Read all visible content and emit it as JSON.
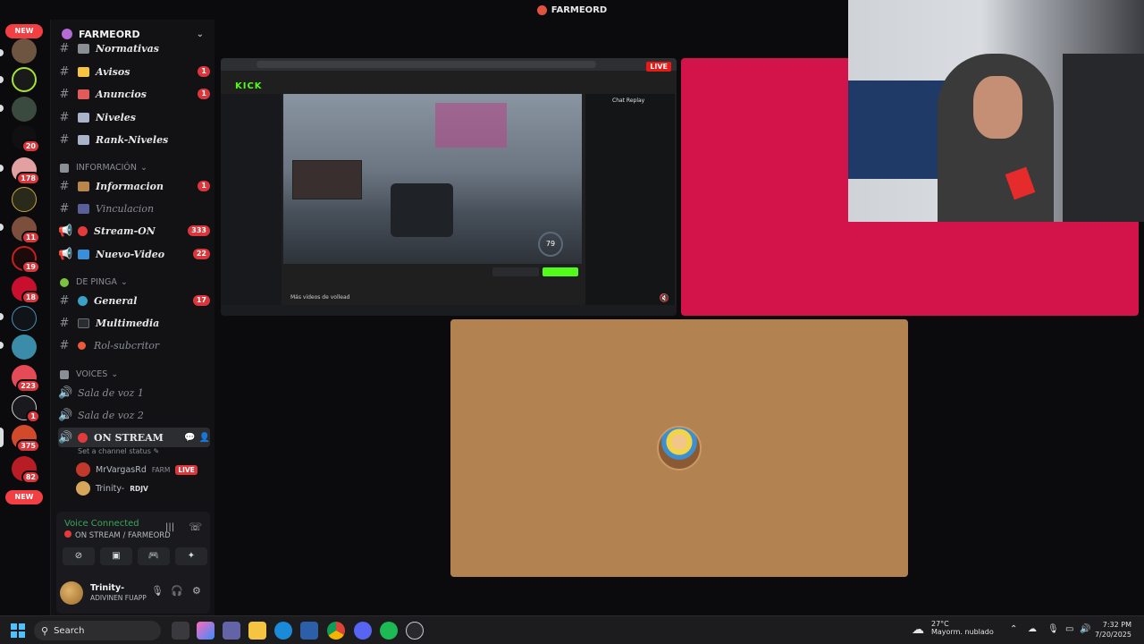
{
  "window": {
    "title": "FARMEORD"
  },
  "rail": {
    "new_top": "NEW",
    "new_bottom": "NEW",
    "badges": [
      "20",
      "178",
      "11",
      "19",
      "18",
      "223",
      "1",
      "375",
      "82"
    ]
  },
  "guild": {
    "name": "FARMEORD"
  },
  "channels": {
    "normativas": "Normativas",
    "avisos": {
      "name": "Avisos",
      "count": "1"
    },
    "anuncios": {
      "name": "Anuncios",
      "count": "1"
    },
    "niveles": {
      "name": "Niveles"
    },
    "rank_niveles": {
      "name": "Rank-Niveles"
    },
    "cat_informacion": "INFORMACIÓN",
    "informacion": {
      "name": "Informacion",
      "count": "1"
    },
    "vinculacion": {
      "name": "Vinculacion"
    },
    "stream_on": {
      "name": "Stream-ON",
      "count": "333"
    },
    "nuevo_video": {
      "name": "Nuevo-Video",
      "count": "22"
    },
    "cat_de_pinga": "DE PINGA",
    "general": {
      "name": "General",
      "count": "17"
    },
    "multimedia": {
      "name": "Multimedia"
    },
    "rol_subcritor": {
      "name": "Rol-subcritor"
    },
    "cat_voices": "VOICES",
    "sala1": {
      "name": "Sala de voz 1"
    },
    "sala2": {
      "name": "Sala de voz 2"
    },
    "on_stream": {
      "name": "ON STREAM"
    },
    "channel_status": "Set a channel status",
    "users": [
      {
        "name": "MrVargasRd",
        "tag": "FARM",
        "live": "LIVE"
      },
      {
        "name": "Trinity-",
        "tag": "RDJV"
      }
    ]
  },
  "voice": {
    "status": "Voice Connected",
    "channel": "ON STREAM / FARMEORD"
  },
  "me": {
    "name": "Trinity-",
    "status": "ADIVINEN FUAPP"
  },
  "screenshare": {
    "brand": "KICK",
    "live": "LIVE",
    "chat_title": "Chat Replay",
    "speed": "79",
    "mas_videos": "Más videos de vollead"
  },
  "taskbar": {
    "search": "Search",
    "weather_temp": "27°C",
    "weather_desc": "Mayorm. nublado",
    "time": "7:32 PM",
    "date": "7/20/2025"
  },
  "colors": {
    "accent_red": "#da373c",
    "voice_green": "#3ba55c",
    "pink_tile": "#d2144a",
    "brown_tile": "#b28250"
  }
}
